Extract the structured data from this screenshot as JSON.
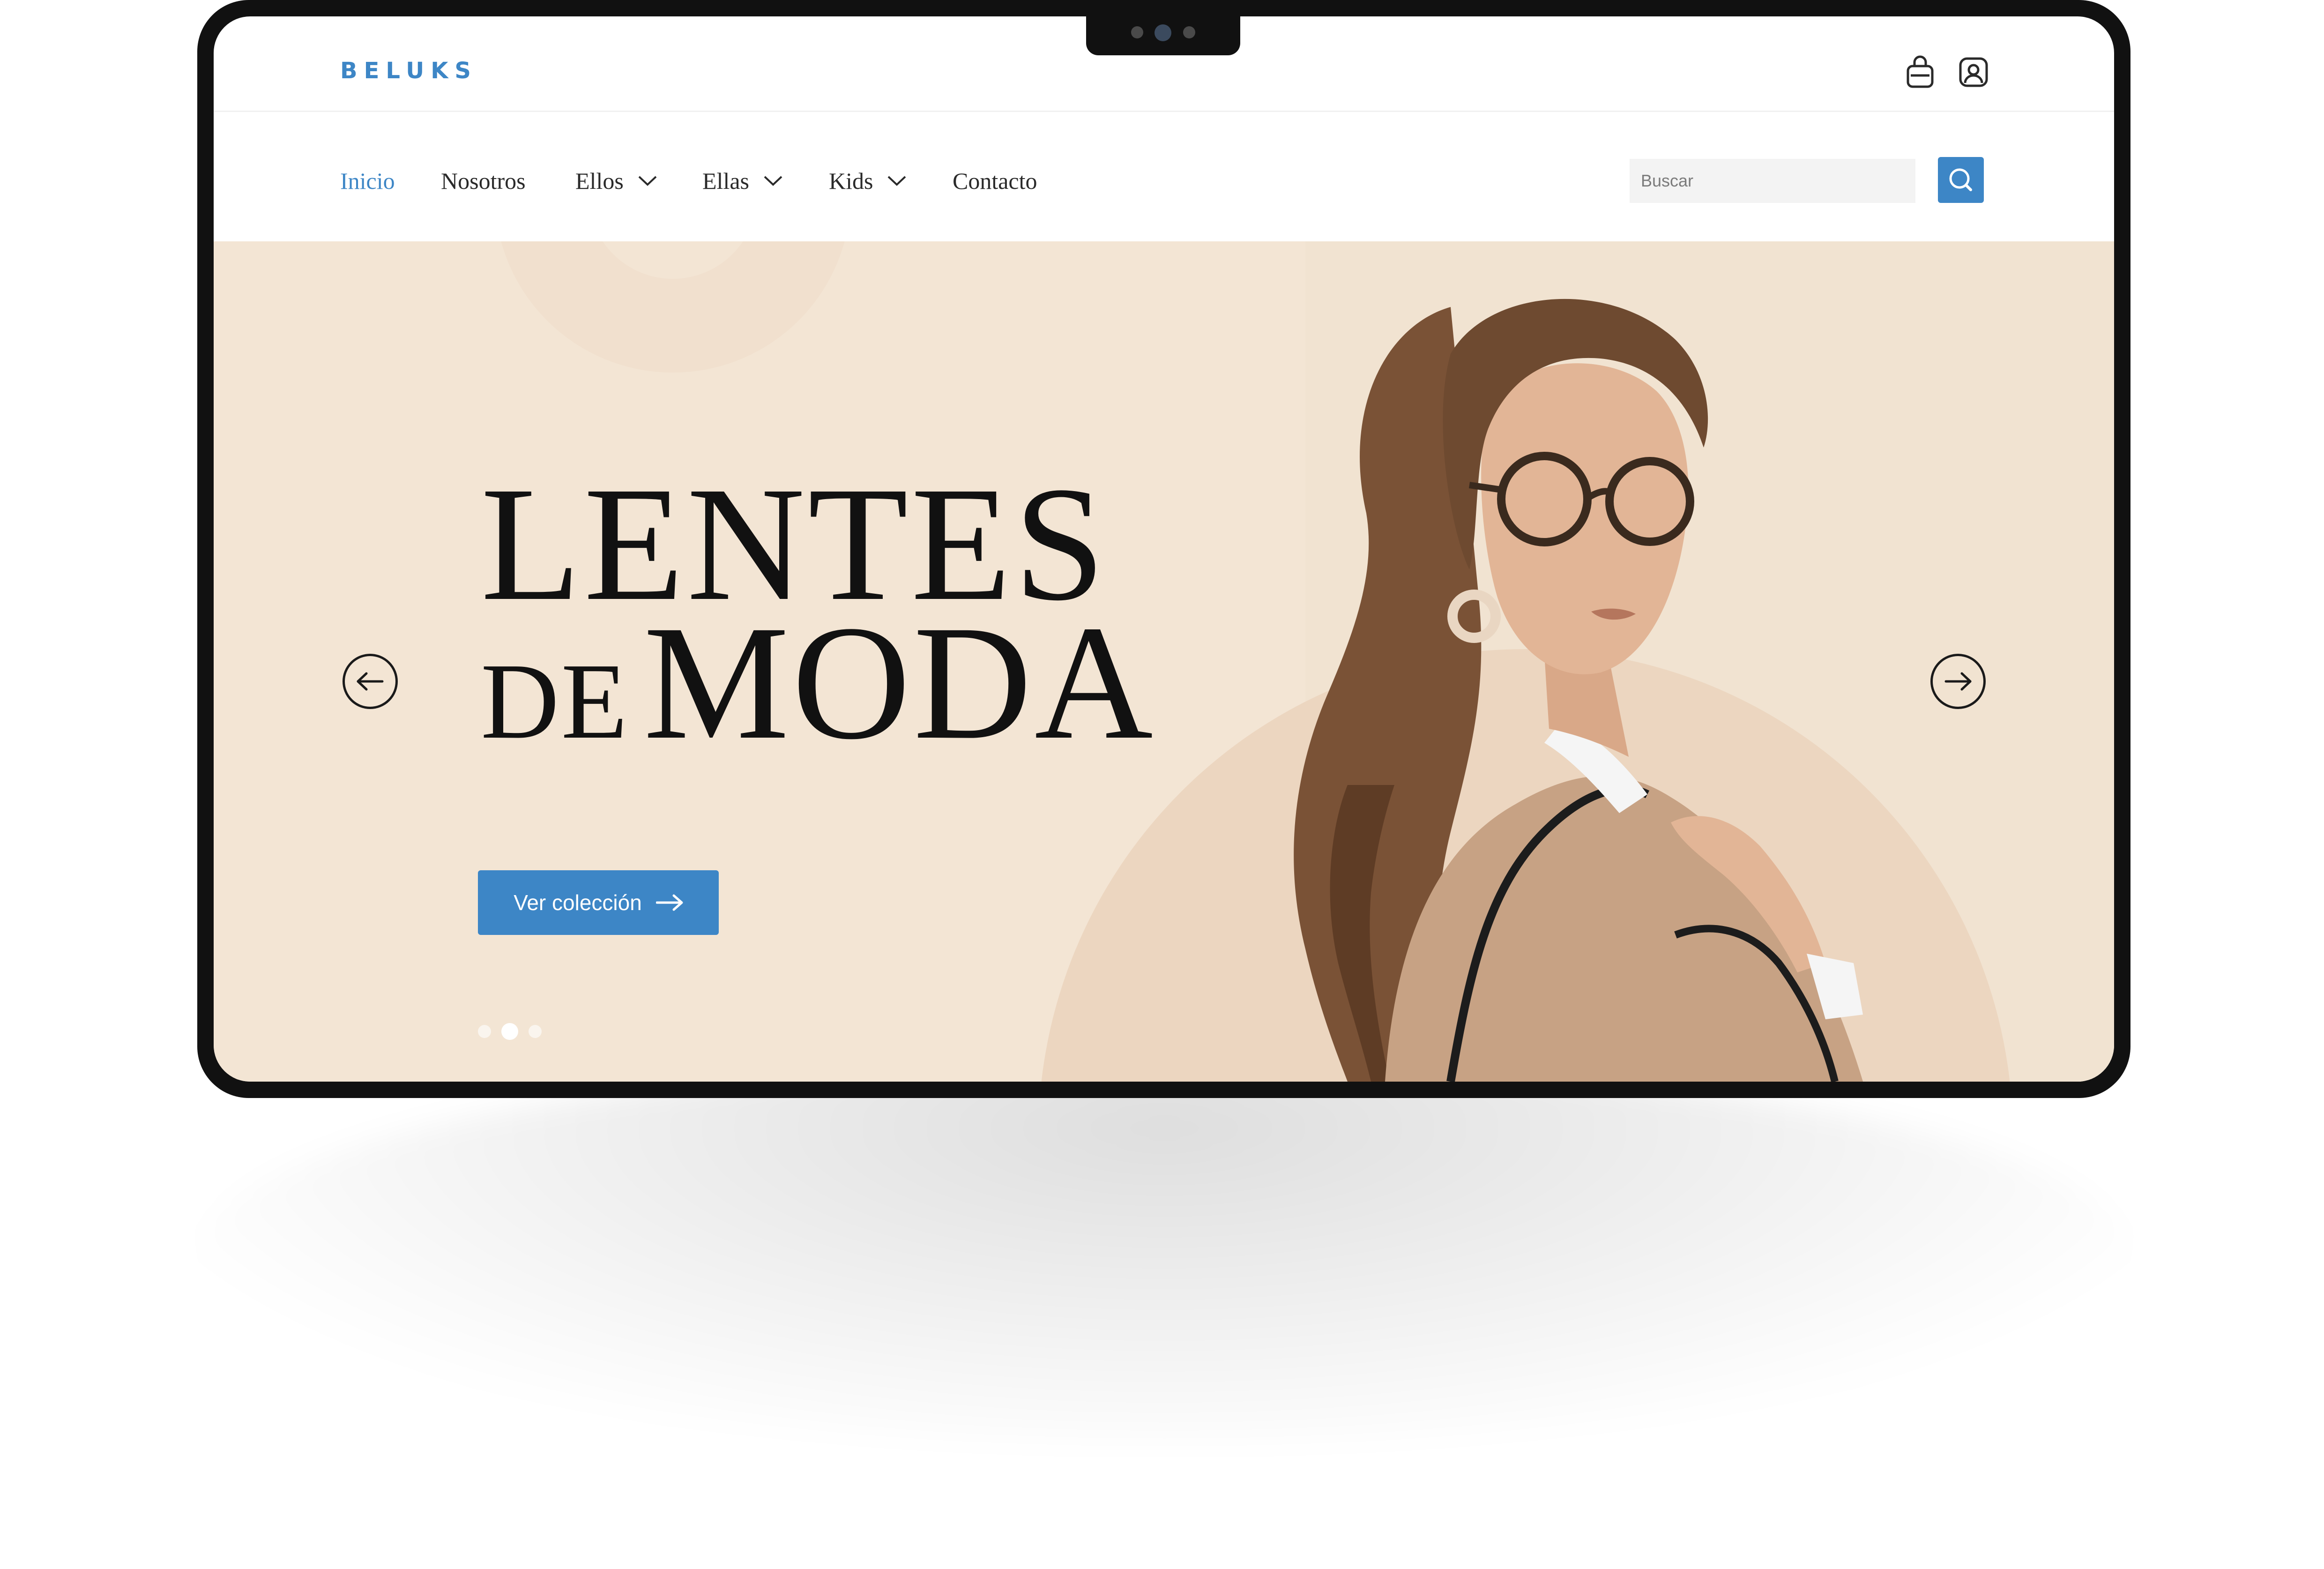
{
  "brand": {
    "logo_text": "BELUKS",
    "accent_color": "#3d86c6"
  },
  "header": {
    "icons": [
      "shopping-bag-icon",
      "user-icon"
    ]
  },
  "nav": {
    "items": [
      {
        "label": "Inicio",
        "active": true,
        "has_dropdown": false
      },
      {
        "label": "Nosotros",
        "active": false,
        "has_dropdown": false
      },
      {
        "label": "Ellos",
        "active": false,
        "has_dropdown": true
      },
      {
        "label": "Ellas",
        "active": false,
        "has_dropdown": true
      },
      {
        "label": "Kids",
        "active": false,
        "has_dropdown": true
      },
      {
        "label": "Contacto",
        "active": false,
        "has_dropdown": false
      }
    ]
  },
  "search": {
    "placeholder": "Buscar",
    "value": "",
    "button_icon": "search-icon"
  },
  "hero": {
    "headline_line1": "LENTES",
    "headline_line2_small": "DE",
    "headline_line2_big": "MODA",
    "cta_label": "Ver colección",
    "cta_icon": "arrow-right-icon",
    "prev_icon": "arrow-left-icon",
    "next_icon": "arrow-right-icon",
    "background_color": "#f3e5d4",
    "slides_total": 3,
    "active_slide": 2
  }
}
